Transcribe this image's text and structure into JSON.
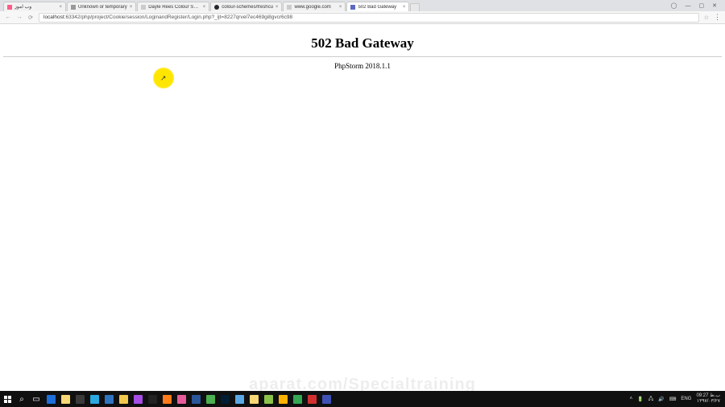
{
  "tabs": [
    {
      "label": "وب آموز",
      "fav": "#ff5c8a"
    },
    {
      "label": "Unknown or temporary",
      "fav": "#999999"
    },
    {
      "label": "Dayle Rees Colour Sche",
      "fav": "#cccccc"
    },
    {
      "label": "colour-schemes/freshcu",
      "fav": "#24292e"
    },
    {
      "label": "www.google.com",
      "fav": "#cccccc"
    },
    {
      "label": "502 Bad Gateway",
      "fav": "#5c6bc0",
      "active": true
    }
  ],
  "window": {
    "user_icon": "◯",
    "min": "—",
    "max": "▢",
    "close": "✕"
  },
  "address": {
    "back": "←",
    "fwd": "→",
    "reload": "⟳",
    "host": "localhost",
    "path": ":63342/php/project/Cookie/session/LoginandRegister/Login.php?_ijt=8227qrvel7ec469gi8gvcr6c98",
    "star": "☆",
    "menu": "⋮"
  },
  "page": {
    "title": "502 Bad Gateway",
    "server": "PhpStorm 2018.1.1"
  },
  "status_text": "",
  "watermark": "aparat.com/Specialtraining",
  "taskbar": {
    "icons": [
      {
        "name": "search-icon",
        "color": "#ffffff",
        "glyph": "⌕"
      },
      {
        "name": "taskview-icon",
        "color": "#ffffff",
        "glyph": "▭"
      },
      {
        "name": "edge-icon",
        "color": "#1e6fd9"
      },
      {
        "name": "explorer-icon",
        "color": "#f8d775"
      },
      {
        "name": "store-icon",
        "color": "#3a3a3a"
      },
      {
        "name": "ie-icon",
        "color": "#2aa8e0"
      },
      {
        "name": "vscode-icon",
        "color": "#2f74c0"
      },
      {
        "name": "chrome-icon",
        "color": "#f2c94c"
      },
      {
        "name": "phpstorm-icon",
        "color": "#a64de6"
      },
      {
        "name": "terminal-icon",
        "color": "#222222"
      },
      {
        "name": "xampp-icon",
        "color": "#ff7b1c"
      },
      {
        "name": "wamp-icon",
        "color": "#e85b9b"
      },
      {
        "name": "word-icon",
        "color": "#2b579a"
      },
      {
        "name": "app1-icon",
        "color": "#4caf50"
      },
      {
        "name": "ps-icon",
        "color": "#001d34"
      },
      {
        "name": "app2-icon",
        "color": "#5aa9e6"
      },
      {
        "name": "folder-icon",
        "color": "#f8d775"
      },
      {
        "name": "app3-icon",
        "color": "#8bc34a"
      },
      {
        "name": "app4-icon",
        "color": "#ffb300"
      },
      {
        "name": "chrome2-icon",
        "color": "#34a853"
      },
      {
        "name": "app5-icon",
        "color": "#d32f2f"
      },
      {
        "name": "app6-icon",
        "color": "#3f51b5"
      }
    ]
  },
  "tray": {
    "chevron": "˄",
    "icons": [
      "🔋",
      "🖧",
      "🔊",
      "⌨"
    ],
    "lang": "ENG",
    "time": "09:27 ب.ظ",
    "date": "۱۳۹۷/۰۳/۲۷"
  }
}
